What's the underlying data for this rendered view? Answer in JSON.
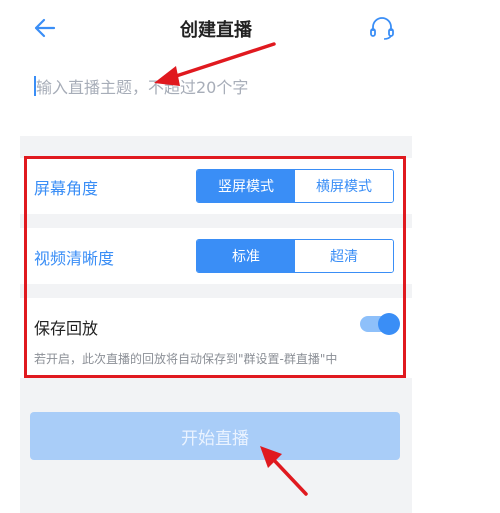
{
  "header": {
    "title": "创建直播",
    "back_icon": "arrow-left-icon",
    "support_icon": "headset-icon"
  },
  "topic": {
    "value": "",
    "placeholder": "输入直播主题，不超过20个字"
  },
  "settings": {
    "screen_angle": {
      "label": "屏幕角度",
      "options": [
        "竖屏模式",
        "横屏模式"
      ],
      "selected": "竖屏模式"
    },
    "video_quality": {
      "label": "视频清晰度",
      "options": [
        "标准",
        "超清"
      ],
      "selected": "标准"
    },
    "save_replay": {
      "label": "保存回放",
      "enabled": true,
      "hint": "若开启，此次直播的回放将自动保存到\"群设置-群直播\"中"
    }
  },
  "start_button": {
    "label": "开始直播"
  },
  "colors": {
    "accent": "#3a8ef6",
    "label_blue": "#3a8ef6",
    "annotation_red": "#e0191f",
    "disabled_button": "#a9cdf8"
  }
}
